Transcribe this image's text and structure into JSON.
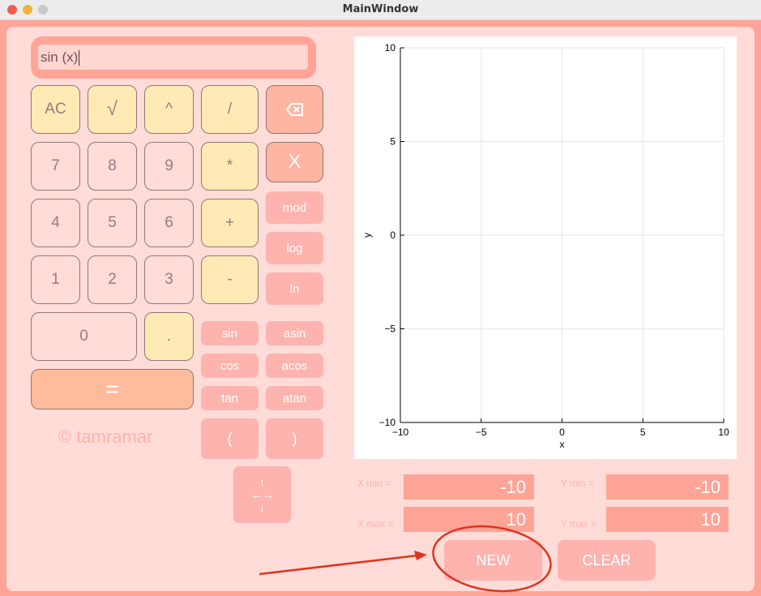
{
  "window": {
    "title": "MainWindow"
  },
  "display": {
    "expression": "sin (x)"
  },
  "keypad": {
    "ac": "AC",
    "sqrt": "√",
    "pow": "^",
    "div": "/",
    "mul": "*",
    "add": "+",
    "sub": "-",
    "d7": "7",
    "d8": "8",
    "d9": "9",
    "d4": "4",
    "d5": "5",
    "d6": "6",
    "d1": "1",
    "d2": "2",
    "d3": "3",
    "d0": "0",
    "dot": ".",
    "equals": "=",
    "x": "X",
    "mod": "mod",
    "log": "log",
    "ln": "ln",
    "sin": "sin",
    "asin": "asin",
    "cos": "cos",
    "acos": "acos",
    "tan": "tan",
    "atan": "atan",
    "lparen": "(",
    "rparen": ")",
    "move_top": "↑",
    "move_mid": "←→",
    "move_bot": "↓"
  },
  "icons": {
    "backspace": "backspace-icon",
    "move": "move-arrows-icon"
  },
  "copyright": "© tamramar",
  "graph": {
    "xlabel": "x",
    "ylabel": "y",
    "x_ticks": [
      "−10",
      "−5",
      "0",
      "5",
      "10"
    ],
    "y_ticks": [
      "10",
      "5",
      "0",
      "−5",
      "−10"
    ]
  },
  "chart_data": {
    "type": "line",
    "xlabel": "x",
    "ylabel": "y",
    "xlim": [
      -10,
      10
    ],
    "ylim": [
      -10,
      10
    ],
    "x_ticks": [
      -10,
      -5,
      0,
      5,
      10
    ],
    "y_ticks": [
      -10,
      -5,
      0,
      5,
      10
    ],
    "grid": true,
    "series": []
  },
  "range": {
    "xmin_label": "X min =",
    "xmin_value": "-10",
    "xmax_label": "X max =",
    "xmax_value": "10",
    "ymin_label": "Y min =",
    "ymin_value": "-10",
    "ymax_label": "Y max =",
    "ymax_value": "10"
  },
  "actions": {
    "new": "NEW",
    "clear": "CLEAR"
  },
  "colors": {
    "accent": "#ffa496",
    "annotation": "#e0341f"
  }
}
